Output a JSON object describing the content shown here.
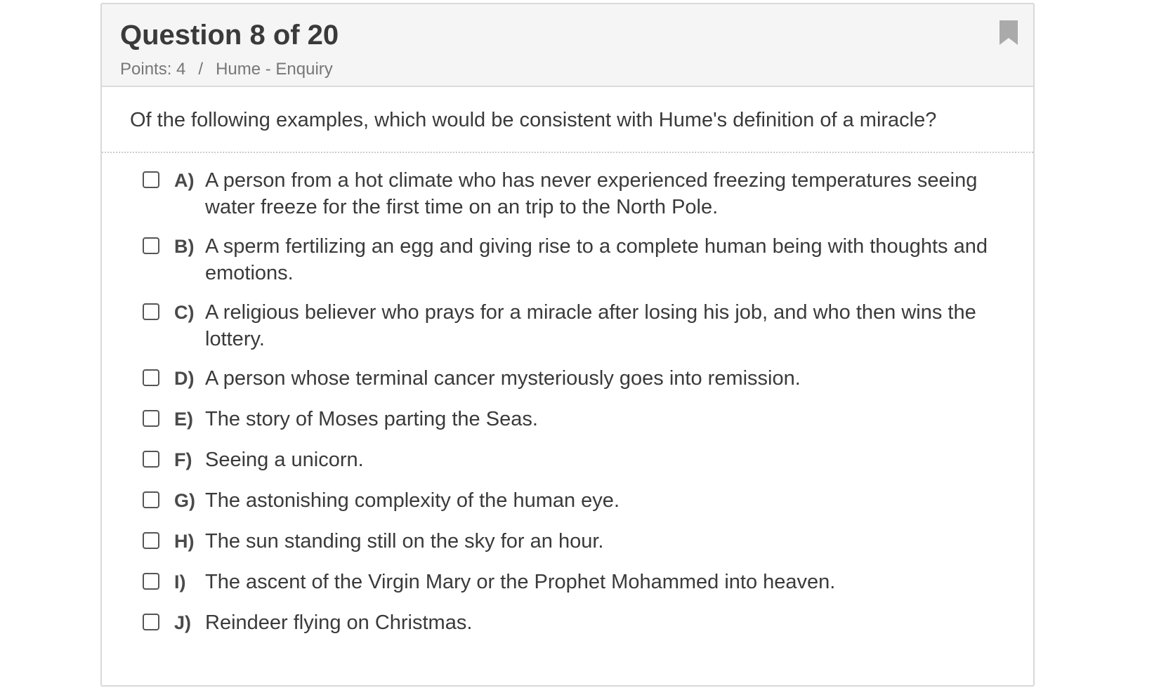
{
  "header": {
    "title": "Question 8 of 20",
    "points": "Points: 4",
    "separator": "/",
    "topic": "Hume - Enquiry",
    "bookmark_icon": "bookmark-icon"
  },
  "question": {
    "prompt": "Of the following examples, which would be consistent with Hume's definition of a miracle?"
  },
  "options": [
    {
      "letter": "A)",
      "text": "A person from a hot climate who has never experienced freezing temperatures seeing water freeze for the first time on an trip to the North Pole.",
      "checked": false
    },
    {
      "letter": "B)",
      "text": "A sperm fertilizing an egg and giving rise to a complete human being with thoughts and emotions.",
      "checked": false
    },
    {
      "letter": "C)",
      "text": "A religious believer who prays for a miracle after losing his job, and who then wins the lottery.",
      "checked": false
    },
    {
      "letter": "D)",
      "text": "A person whose terminal cancer mysteriously goes into remission.",
      "checked": false
    },
    {
      "letter": "E)",
      "text": "The story of Moses parting the Seas.",
      "checked": false
    },
    {
      "letter": "F)",
      "text": "Seeing a unicorn.",
      "checked": false
    },
    {
      "letter": "G)",
      "text": "The astonishing complexity of the human eye.",
      "checked": false
    },
    {
      "letter": "H)",
      "text": "The sun standing still on the sky for an hour.",
      "checked": false
    },
    {
      "letter": "I)",
      "text": "The ascent of the Virgin Mary or the Prophet Mohammed into heaven.",
      "checked": false
    },
    {
      "letter": "J)",
      "text": "Reindeer flying on Christmas.",
      "checked": false
    }
  ],
  "colors": {
    "header_bg": "#f5f5f5",
    "border": "#d8d8d8",
    "text": "#3a3a3a",
    "muted": "#777777",
    "bookmark": "#aaaaaa"
  }
}
